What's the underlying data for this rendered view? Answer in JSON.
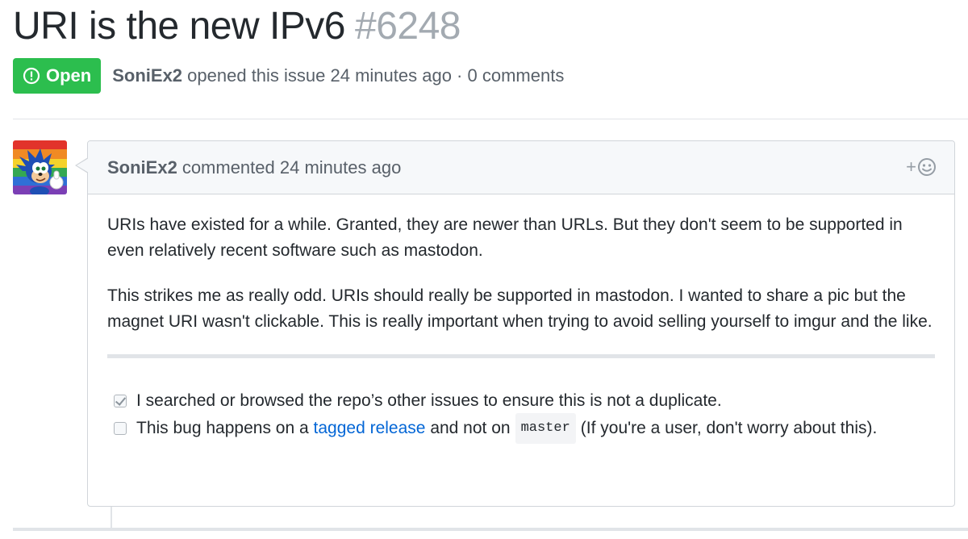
{
  "issue": {
    "title": "URI is the new IPv6",
    "number": "#6248",
    "state": "Open",
    "author": "SoniEx2",
    "meta_text": "opened this issue 24 minutes ago · 0 comments"
  },
  "comment": {
    "author": "SoniEx2",
    "timestamp": "commented 24 minutes ago",
    "reaction_label": "+",
    "paragraphs": [
      "URIs have existed for a while. Granted, they are newer than URLs. But they don't seem to be supported in even relatively recent software such as mastodon.",
      "This strikes me as really odd. URIs should really be supported in mastodon. I wanted to share a pic but the magnet URI wasn't clickable. This is really important when trying to avoid selling yourself to imgur and the like."
    ],
    "tasks": [
      {
        "checked": true,
        "text": "I searched or browsed the repo’s other issues to ensure this is not a duplicate."
      },
      {
        "checked": false,
        "prefix": "This bug happens on a",
        "link_text": "tagged release",
        "middle": "and not on",
        "code": "master",
        "suffix": "(If you're a user, don't worry about this)."
      }
    ]
  },
  "icons": {
    "state": "issue-opened-icon",
    "reaction": "smiley-icon",
    "avatar": "sonic-avatar-image"
  },
  "colors": {
    "open_green": "#2cbe4e",
    "link_blue": "#0366d6",
    "muted_text": "#586069",
    "number_gray": "#a3aab1"
  }
}
